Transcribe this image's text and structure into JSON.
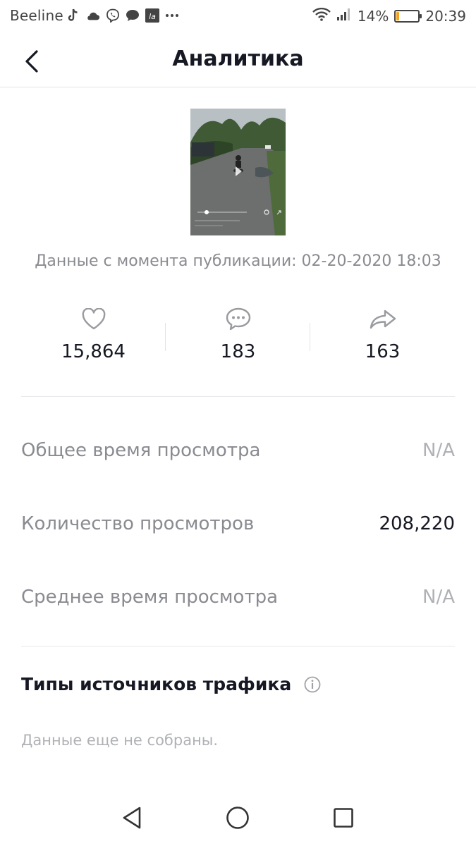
{
  "status_bar": {
    "carrier": "Beeline",
    "left_icons": [
      "tiktok-icon",
      "cloud-icon",
      "viber-icon",
      "chat-bubble-icon",
      "app-la-icon",
      "more-dots-icon"
    ],
    "battery_percent": "14%",
    "battery_level": 0.14,
    "time": "20:39"
  },
  "header": {
    "title": "Аналитика",
    "back_icon": "chevron-left-icon"
  },
  "video": {
    "published_text": "Данные с момента публикации: 02-20-2020 18:03"
  },
  "stats": [
    {
      "icon": "heart-icon",
      "value": "15,864"
    },
    {
      "icon": "comment-icon",
      "value": "183"
    },
    {
      "icon": "share-icon",
      "value": "163"
    }
  ],
  "metrics": [
    {
      "label": "Общее время просмотра",
      "value": "N/A"
    },
    {
      "label": "Количество просмотров",
      "value": "208,220"
    },
    {
      "label": "Среднее время просмотра",
      "value": "N/A"
    }
  ],
  "traffic": {
    "title": "Типы источников трафика",
    "empty": "Данные еще не собраны."
  },
  "colors": {
    "text_primary": "#161823",
    "text_secondary": "#8a8b91",
    "text_muted": "#b0b1b5",
    "divider": "#e8e8ea",
    "battery": "#f3a31d"
  }
}
